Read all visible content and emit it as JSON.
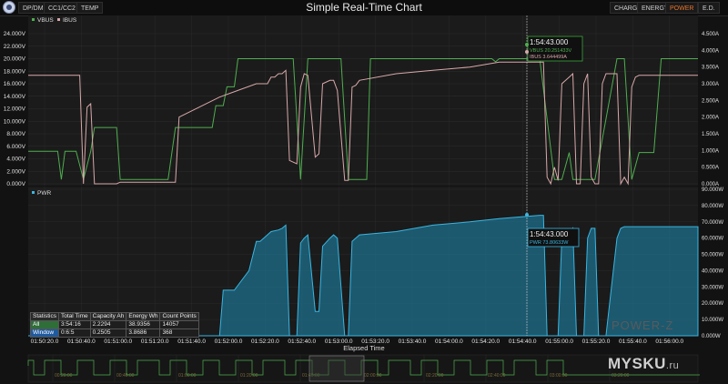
{
  "header": {
    "title": "Simple Real-Time Chart",
    "left_tabs": [
      "DP/DM",
      "CC1/CC2",
      "TEMP"
    ],
    "right_tabs": [
      "CHARGE",
      "ENERGY",
      "POWER",
      "E.D."
    ],
    "active_right_tab": "POWER"
  },
  "colors": {
    "vbus": "#4fae4f",
    "ibus": "#d9a8aa",
    "pwr_line": "#3ab6e0",
    "pwr_fill": "#1d6f8c",
    "accent_active": "#e8742c",
    "marker_box": "#3aa83a"
  },
  "chart_data": [
    {
      "type": "line",
      "series": [
        {
          "name": "VBUS",
          "unit": "V",
          "x": [
            0,
            6,
            8,
            9,
            10,
            11,
            13,
            15,
            17,
            18,
            19,
            20,
            24,
            25,
            26,
            38,
            40,
            41,
            48,
            50,
            51,
            52,
            53,
            54,
            56,
            57,
            60,
            61,
            70,
            72,
            74,
            76,
            78,
            83,
            85,
            87,
            89,
            92,
            93,
            96,
            98,
            99,
            100,
            110,
            111,
            124,
            126,
            127,
            128,
            139,
            143,
            145,
            147,
            148,
            152,
            154,
            160,
            162,
            164,
            166,
            170,
            172,
            174,
            176,
            178,
            180,
            182
          ],
          "y": [
            5.2,
            5.2,
            5.2,
            0.7,
            5.2,
            5.2,
            5.2,
            0.7,
            5.2,
            9,
            9,
            9,
            9,
            0.7,
            0.7,
            0.7,
            9,
            9,
            9,
            9,
            12.5,
            12.5,
            12.5,
            15.5,
            15.5,
            20,
            20,
            20,
            20,
            20,
            0.7,
            20,
            20,
            20,
            20,
            0.7,
            0.7,
            0.7,
            20,
            20,
            20,
            20,
            20,
            20,
            20,
            20,
            20,
            19.5,
            20,
            20,
            0.7,
            0.7,
            5,
            0.7,
            0.7,
            0.7,
            20,
            20,
            0.7,
            5,
            5,
            20,
            20,
            20,
            20,
            20,
            20
          ]
        },
        {
          "name": "IBUS",
          "unit": "A",
          "x": [
            0,
            13,
            14,
            15,
            16,
            17,
            18,
            24,
            25,
            30,
            32,
            34,
            35,
            38,
            40,
            41,
            52,
            62,
            63,
            64,
            65,
            66,
            67,
            68,
            69,
            70,
            71,
            73,
            74,
            75,
            76,
            78,
            79,
            80,
            82,
            83,
            84,
            86,
            87,
            88,
            89,
            90,
            100,
            110,
            120,
            128,
            139,
            140,
            141,
            142,
            143,
            144,
            145,
            147,
            148,
            149,
            150,
            151,
            152,
            153,
            154,
            155,
            156,
            157,
            160,
            161,
            162,
            163,
            164,
            165,
            166,
            168,
            170,
            172,
            174,
            176,
            178,
            180,
            182
          ],
          "y": [
            3.25,
            3.25,
            3.25,
            0,
            2.3,
            2.4,
            0,
            0,
            0.05,
            0.05,
            0.05,
            0.05,
            0.05,
            0.05,
            0.05,
            2.0,
            2.6,
            3.0,
            3.0,
            3.0,
            3.0,
            3.2,
            3.2,
            3.3,
            3.3,
            3.4,
            0.7,
            0.6,
            2.9,
            3.3,
            3.25,
            0.8,
            0.9,
            3.0,
            3.1,
            3.1,
            2.8,
            0.1,
            0.1,
            2.9,
            2.95,
            3.1,
            3.3,
            3.4,
            3.5,
            3.65,
            3.65,
            3.65,
            0.2,
            0,
            0.5,
            0.1,
            3.0,
            3.2,
            3.3,
            0,
            0,
            3.0,
            3.3,
            0.2,
            0,
            0,
            3.0,
            3.3,
            3.3,
            0,
            0.2,
            0,
            2.9,
            3.2,
            3.25,
            3.25,
            3.25,
            3.25,
            3.25,
            3.25,
            3.25,
            3.25,
            3.25
          ]
        }
      ],
      "x_range": [
        0,
        182
      ],
      "y_left_label": "V",
      "y_right_label": "A",
      "y_left_ticks": [
        "0.000V",
        "2.000V",
        "4.000V",
        "6.000V",
        "8.000V",
        "10.000V",
        "12.000V",
        "14.000V",
        "16.000V",
        "18.000V",
        "20.000V",
        "22.000V",
        "24.000V"
      ],
      "y_right_ticks": [
        "0.000A",
        "0.500A",
        "1.000A",
        "1.500A",
        "2.000A",
        "2.500A",
        "3.000A",
        "3.500A",
        "4.000A",
        "4.500A"
      ],
      "marker": {
        "time": "1:54:43.000",
        "vbus": "VBUS  20.251433V",
        "ibus": "IBUS   3.644499A"
      }
    },
    {
      "type": "area",
      "series": [
        {
          "name": "PWR",
          "unit": "W",
          "x": [
            0,
            35,
            36,
            40,
            45,
            48,
            50,
            52,
            53,
            54,
            56,
            57,
            60,
            62,
            63,
            64,
            66,
            68,
            69,
            70,
            71,
            73,
            74,
            75,
            76,
            78,
            79,
            80,
            82,
            83,
            84,
            86,
            87,
            88,
            89,
            90,
            100,
            110,
            120,
            128,
            139,
            140,
            141,
            142,
            143,
            144,
            145,
            147,
            148,
            149,
            150,
            151,
            152,
            153,
            154,
            155,
            156,
            157,
            160,
            161,
            162,
            163,
            164,
            165,
            166,
            168,
            170,
            172,
            174,
            176,
            178,
            180,
            182
          ],
          "y": [
            0,
            0,
            0,
            0,
            0,
            0,
            0,
            0,
            28,
            28,
            28,
            31,
            40,
            58,
            58,
            60,
            64,
            65,
            66,
            68,
            0,
            0,
            57,
            60,
            62,
            15,
            15,
            55,
            60,
            62,
            60,
            0,
            0,
            58,
            60,
            62,
            64,
            68,
            70,
            72,
            74,
            74,
            0,
            0,
            0,
            0,
            60,
            62,
            66,
            0,
            0,
            0,
            60,
            66,
            66,
            0,
            0,
            0,
            60,
            66,
            67,
            67,
            67,
            67,
            67,
            67,
            67,
            67,
            67,
            67,
            67,
            67,
            67
          ]
        }
      ],
      "x_range": [
        0,
        182
      ],
      "y_right_ticks": [
        "0.000W",
        "10.000W",
        "20.000W",
        "30.000W",
        "40.000W",
        "50.000W",
        "60.000W",
        "70.000W",
        "80.000W",
        "90.000W"
      ],
      "marker": {
        "time": "1:54:43.000",
        "pwr": "PWR   73.80633W"
      },
      "x_ticks": [
        "01:50:20.0",
        "01:50:40.0",
        "01:51:00.0",
        "01:51:20.0",
        "01:51:40.0",
        "01:52:00.0",
        "01:52:20.0",
        "01:52:40.0",
        "01:53:00.0",
        "01:53:20.0",
        "01:53:40.0",
        "01:54:00.0",
        "01:54:20.0",
        "01:54:40.0",
        "01:55:00.0",
        "01:55:20.0",
        "01:55:40.0",
        "01:56:00.0"
      ],
      "xlabel": "Elapsed Time"
    }
  ],
  "legends": {
    "top": [
      "VBUS",
      "IBUS"
    ],
    "bottom": [
      "PWR"
    ]
  },
  "statistics": {
    "headers": [
      "Statistics",
      "Total Time",
      "Capacity Ah",
      "Energy Wh",
      "Count Points"
    ],
    "rows": [
      [
        "All",
        "3:54:16",
        "2.2294",
        "38.9356",
        "14057"
      ],
      [
        "Window",
        "0:6:5",
        "0.2505",
        "3.8686",
        "368"
      ]
    ]
  },
  "overview": {
    "ticks": [
      "00:20:00",
      "00:40:00",
      "01:00:00",
      "01:20:00",
      "01:40:00",
      "02:00:00",
      "02:20:00",
      "02:40:00",
      "03:00:00",
      "03:20:00"
    ]
  },
  "branding": {
    "device": "POWER-Z",
    "watermark": "MYSKU",
    "watermark_domain": ".ru"
  }
}
